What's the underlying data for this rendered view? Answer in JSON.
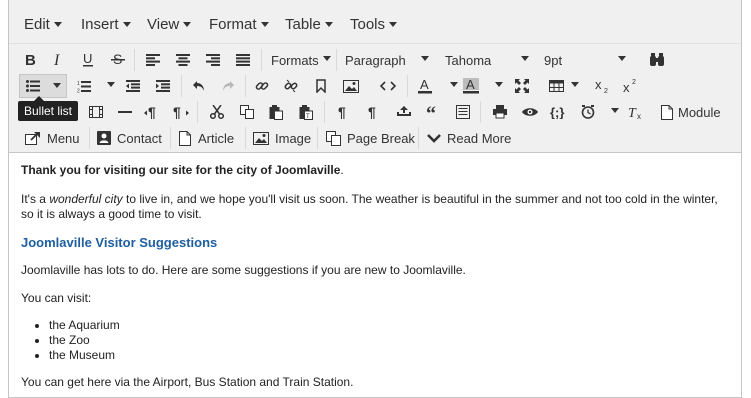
{
  "menubar": {
    "items": [
      "Edit",
      "Insert",
      "View",
      "Format",
      "Table",
      "Tools"
    ]
  },
  "toolbar": {
    "formats_label": "Formats",
    "paragraph_label": "Paragraph",
    "font_family": "Tahoma",
    "font_size": "9pt",
    "module_label": "Module",
    "menu_label": "Menu",
    "contact_label": "Contact",
    "article_label": "Article",
    "image_label": "Image",
    "page_break_label": "Page Break",
    "read_more_label": "Read More"
  },
  "tooltip": {
    "text": "Bullet list"
  },
  "content": {
    "p1": "Thank you for visiting our site for the city of Joomlaville",
    "p1_end": ".",
    "p2_a": "It's a ",
    "p2_em": "wonderful city",
    "p2_b": " to live in, and we hope you'll visit us soon. The weather is beautiful in the summer and not too cold in the winter, so it is always a good time to visit.",
    "heading": "Joomlaville Visitor Suggestions",
    "p3": "Joomlaville has lots to do. Here are some suggestions if you are new to Joomlaville.",
    "p4": "You can visit:",
    "list": [
      "the Aquarium",
      "the Zoo",
      "the Museum"
    ],
    "p5": "You can get here via the Airport, Bus Station and Train Station."
  },
  "colors": {
    "toolbar_bg": "#f0f0f0",
    "link": "#1f5fa0",
    "tooltip_bg": "#222222"
  }
}
